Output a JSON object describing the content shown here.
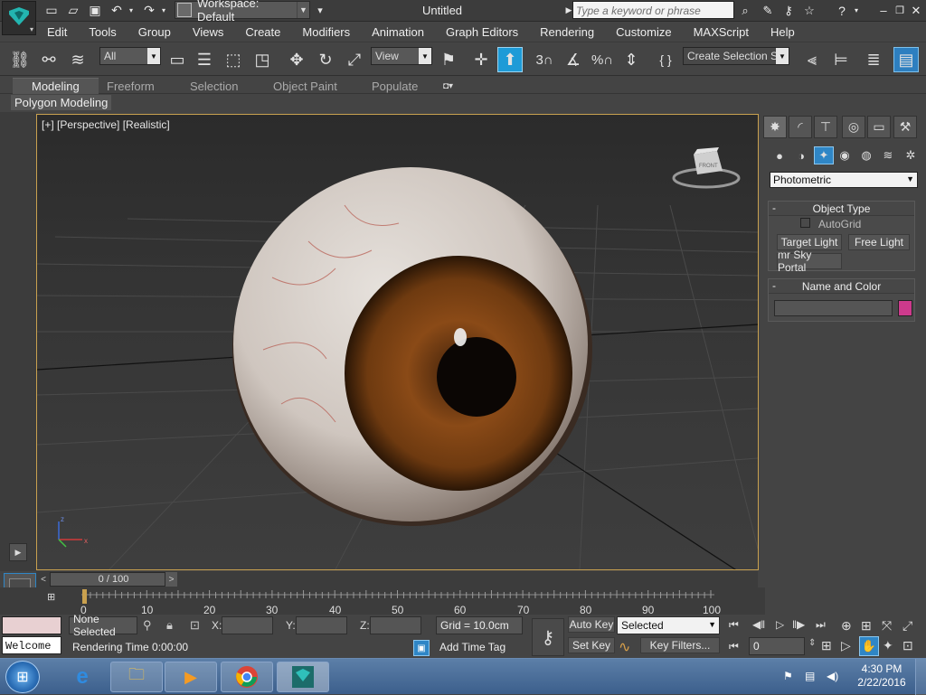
{
  "app": {
    "title": "Untitled",
    "logo_label": "3ds Max"
  },
  "workspace": {
    "label": "Workspace: Default"
  },
  "search": {
    "placeholder": "Type a keyword or phrase"
  },
  "menu": [
    "Edit",
    "Tools",
    "Group",
    "Views",
    "Create",
    "Modifiers",
    "Animation",
    "Graph Editors",
    "Rendering",
    "Customize",
    "MAXScript",
    "Help"
  ],
  "toolbar": {
    "filter_select": "All",
    "view_select": "View",
    "selection_set": "Create Selection Se"
  },
  "ribbon": {
    "tabs": [
      "Modeling",
      "Freeform",
      "Selection",
      "Object Paint",
      "Populate"
    ],
    "sub_label": "Polygon Modeling"
  },
  "viewport": {
    "label": "[+] [Perspective] [Realistic]",
    "viewcube_label": "FRONT",
    "axis_z": "z",
    "axis_x": "x"
  },
  "command_panel": {
    "category": "Photometric",
    "object_type": {
      "title": "Object Type",
      "autogrid": "AutoGrid",
      "buttons": [
        "Target Light",
        "Free Light",
        "mr Sky Portal"
      ]
    },
    "name_color": {
      "title": "Name and Color",
      "name_value": "",
      "swatch": "#cc3a8c"
    }
  },
  "timeline": {
    "slider": "0 / 100",
    "ticks": [
      "0",
      "10",
      "20",
      "30",
      "40",
      "50",
      "60",
      "70",
      "80",
      "90",
      "100"
    ]
  },
  "status": {
    "selection": "None Selected",
    "x_label": "X:",
    "y_label": "Y:",
    "z_label": "Z:",
    "x_value": "",
    "y_value": "",
    "z_value": "",
    "grid": "Grid = 10.0cm",
    "auto_key": "Auto Key",
    "key_mode": "Selected",
    "set_key": "Set Key",
    "key_filters": "Key Filters...",
    "frame": "0",
    "rendering_time": "Rendering Time  0:00:00",
    "add_time_tag": "Add Time Tag",
    "welcome": "Welcome"
  },
  "taskbar": {
    "time": "4:30 PM",
    "date": "2/22/2016"
  },
  "colors": {
    "viewport_border": "#c9a14f",
    "accent": "#1e9bd7",
    "taskbar": "#3c5f8c"
  }
}
